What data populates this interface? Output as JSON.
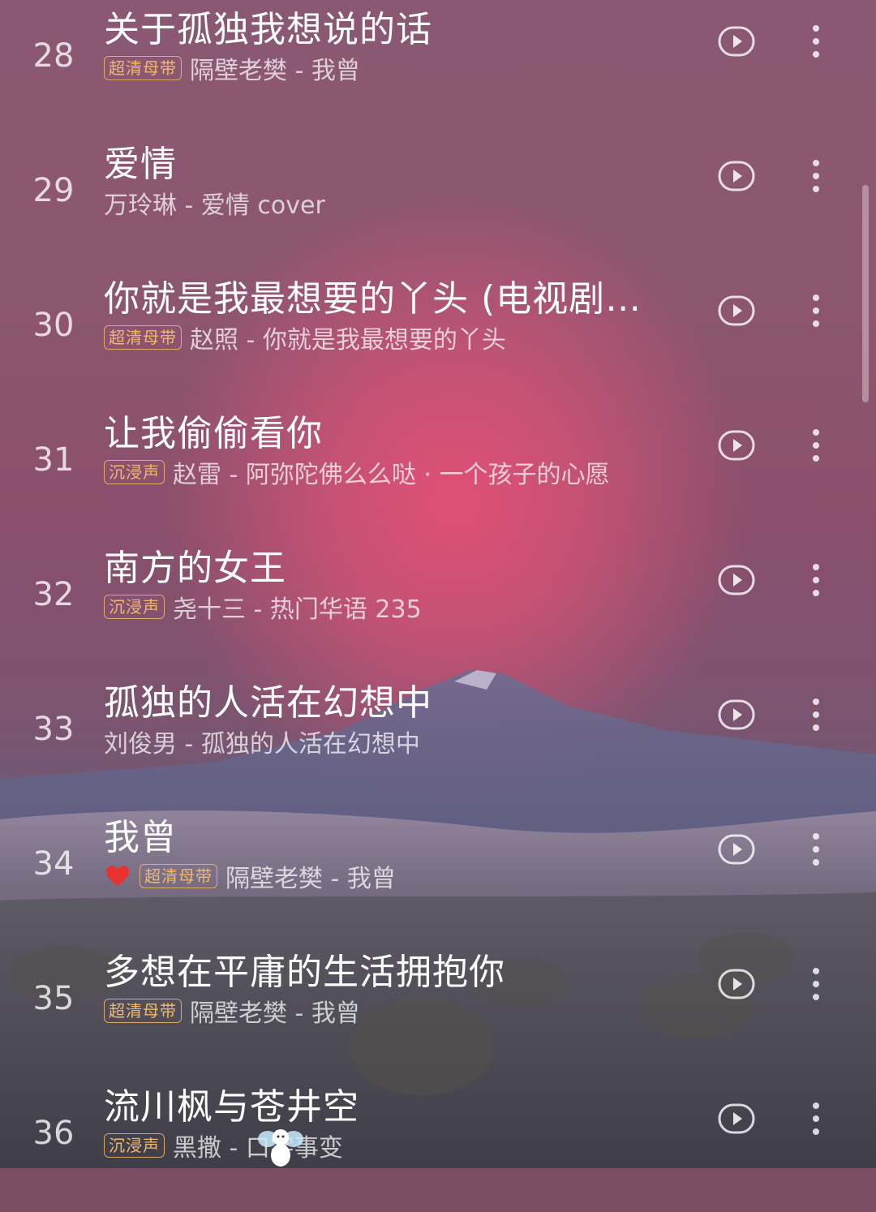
{
  "songs": [
    {
      "rank": "28",
      "title": "关于孤独我想说的话",
      "badge": "超清母带",
      "liked": false,
      "subtitle": "隔壁老樊 - 我曾"
    },
    {
      "rank": "29",
      "title": "爱情",
      "badge": "",
      "liked": false,
      "subtitle": "万玲琳 - 爱情 cover"
    },
    {
      "rank": "30",
      "title": "你就是我最想要的丫头 (电视剧…",
      "badge": "超清母带",
      "liked": false,
      "subtitle": "赵照 - 你就是我最想要的丫头"
    },
    {
      "rank": "31",
      "title": "让我偷偷看你",
      "badge": "沉浸声",
      "liked": false,
      "subtitle": "赵雷 - 阿弥陀佛么么哒 · 一个孩子的心愿"
    },
    {
      "rank": "32",
      "title": "南方的女王",
      "badge": "沉浸声",
      "liked": false,
      "subtitle": "尧十三 - 热门华语 235"
    },
    {
      "rank": "33",
      "title": "孤独的人活在幻想中",
      "badge": "",
      "liked": false,
      "subtitle": "刘俊男 - 孤独的人活在幻想中"
    },
    {
      "rank": "34",
      "title": "我曾",
      "badge": "超清母带",
      "liked": true,
      "subtitle": "隔壁老樊 - 我曾"
    },
    {
      "rank": "35",
      "title": "多想在平庸的生活拥抱你",
      "badge": "超清母带",
      "liked": false,
      "subtitle": "隔壁老樊 - 我曾"
    },
    {
      "rank": "36",
      "title": "流川枫与苍井空",
      "badge": "沉浸声",
      "liked": false,
      "subtitle": "黑撒 - 口字事变"
    }
  ],
  "icons": {
    "play": "play-circle-icon",
    "more": "more-vertical-icon",
    "liked": "heart-icon"
  },
  "colors": {
    "badge": "#f3b86a",
    "heart": "#e8322f",
    "text": "#ffffff"
  }
}
